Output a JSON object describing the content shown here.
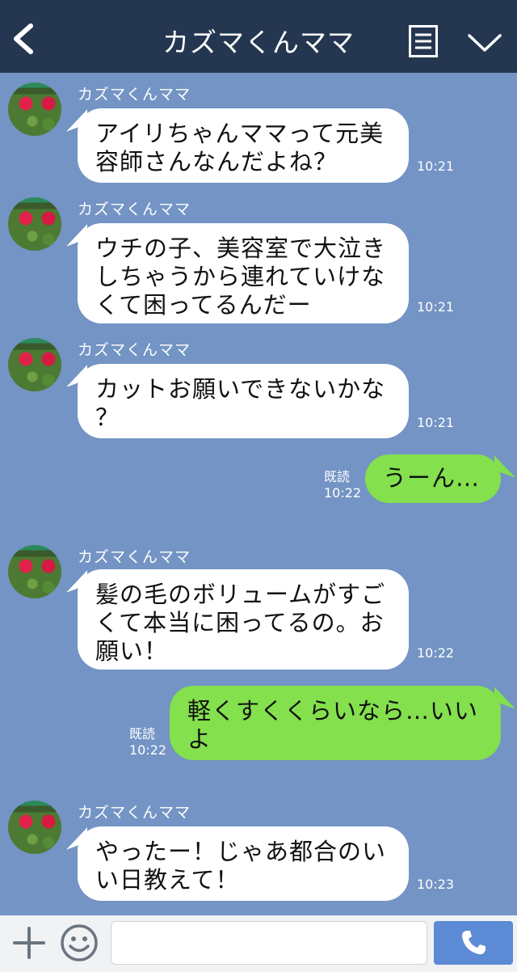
{
  "header": {
    "title": "カズマくんママ"
  },
  "messages": [
    {
      "type": "in",
      "sender": "カズマくんママ",
      "lines": [
        "アイリちゃんママって元美",
        "容師さんなんだよね？"
      ],
      "time": "10:21"
    },
    {
      "type": "in",
      "sender": "カズマくんママ",
      "lines": [
        "ウチの子、美容室で大泣き",
        "しちゃうから連れていけな",
        "くて困ってるんだー"
      ],
      "time": "10:21"
    },
    {
      "type": "in",
      "sender": "カズマくんママ",
      "lines": [
        "カットお願いできないかな",
        "？"
      ],
      "time": "10:21"
    },
    {
      "type": "out",
      "read": "既読",
      "lines": [
        "うーん…"
      ],
      "time": "10:22"
    },
    {
      "type": "in",
      "sender": "カズマくんママ",
      "lines": [
        "髪の毛のボリュームがすご",
        "くて本当に困ってるの。お",
        "願い！"
      ],
      "time": "10:22"
    },
    {
      "type": "out",
      "read": "既読",
      "lines": [
        "軽くすくくらいなら…いい",
        "よ"
      ],
      "time": "10:22"
    },
    {
      "type": "in",
      "sender": "カズマくんママ",
      "lines": [
        "やったー！じゃあ都合のい",
        "い日教えて！"
      ],
      "time": "10:23"
    }
  ],
  "input": {
    "placeholder": ""
  },
  "icons": {
    "back": "back-chevron-icon",
    "menu": "menu-list-icon",
    "collapse": "chevron-down-icon",
    "plus": "plus-icon",
    "emoji": "smile-icon",
    "call": "phone-icon"
  },
  "colors": {
    "header_bg": "#253750",
    "chat_bg": "#7394c4",
    "incoming_bubble": "#ffffff",
    "outgoing_bubble": "#84e04d",
    "call_button": "#5d8ad4"
  }
}
